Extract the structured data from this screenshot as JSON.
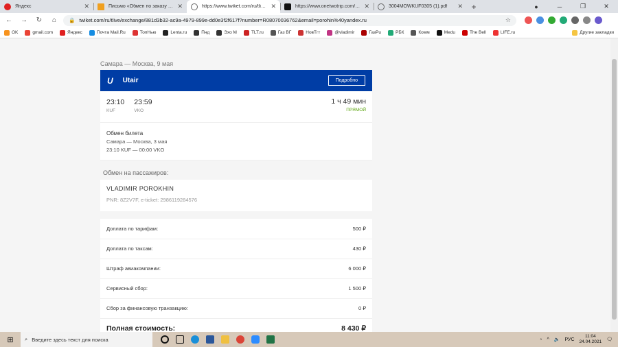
{
  "browser": {
    "tabs": [
      {
        "label": "Яндекс",
        "color": "#e02020",
        "active": false
      },
      {
        "label": "Письмо «Обмен по заказу R08",
        "color": "#f0a020",
        "active": false
      },
      {
        "label": "https://www.twiket.com/ru/tlive/",
        "color": "#666666",
        "active": true
      },
      {
        "label": "https://www.onetwotrip.com/ru/",
        "color": "#111111",
        "active": false
      },
      {
        "label": "3004MOWKUF0305 (1).pdf",
        "color": "#666666",
        "active": false
      }
    ],
    "url": "twiket.com/ru/tlive/exchange/881d3b32-ac9a-4979-899e-dd0e3f2f617f?number=R08070036762&email=porohin%40yandex.ru",
    "bookmarks": [
      {
        "label": "OK",
        "color": "#f7931e"
      },
      {
        "label": "gmail.com",
        "color": "#ea4335"
      },
      {
        "label": "Яндекс",
        "color": "#e02020"
      },
      {
        "label": "Почта Mail.Ru",
        "color": "#168de2"
      },
      {
        "label": "ТопНью",
        "color": "#d33"
      },
      {
        "label": "Lenta.ru",
        "color": "#222"
      },
      {
        "label": "Пнд",
        "color": "#333"
      },
      {
        "label": "Эхо М",
        "color": "#333"
      },
      {
        "label": "TLT.ru",
        "color": "#c22"
      },
      {
        "label": "Газ ВГ",
        "color": "#555"
      },
      {
        "label": "НовТгт",
        "color": "#c33"
      },
      {
        "label": "@vladimir",
        "color": "#c13584"
      },
      {
        "label": "ГазРu",
        "color": "#a00"
      },
      {
        "label": "РБК",
        "color": "#2a7"
      },
      {
        "label": "Комм",
        "color": "#555"
      },
      {
        "label": "Medu",
        "color": "#111"
      },
      {
        "label": "The Bell",
        "color": "#c00"
      },
      {
        "label": "LIFE.ru",
        "color": "#e33"
      }
    ],
    "other_bookmarks": "Другие закладки"
  },
  "trip": {
    "route_title": "Самара — Москва, 9 мая",
    "airline": "Utair",
    "details_button": "Подробно",
    "dep_time": "23:10",
    "dep_code": "KUF",
    "arr_time": "23:59",
    "arr_code": "VKO",
    "duration": "1 ч 49 мин",
    "flight_type": "прямой",
    "exchange_title": "Обмен билета",
    "exchange_route": "Самара — Москва, 3 мая",
    "exchange_times": "23:10 KUF — 00:00 VKO"
  },
  "passengers": {
    "title": "Обмен на пассажиров:",
    "name": "VLADIMIR POROKHIN",
    "pnr": "PNR: 8Z2V7F, e-ticket: 2986119284576"
  },
  "costs": {
    "rows": [
      {
        "label": "Доплата по тарифам:",
        "value": "500 ₽"
      },
      {
        "label": "Доплата по таксам:",
        "value": "430 ₽"
      },
      {
        "label": "Штраф авиакомпании:",
        "value": "6 000 ₽"
      },
      {
        "label": "Сервисный сбор:",
        "value": "1 500 ₽"
      },
      {
        "label": "Сбор за финансовую транзакцию:",
        "value": "0 ₽"
      }
    ],
    "total_label": "Полная стоимость:",
    "total_value": "8 430 ₽"
  },
  "taskbar": {
    "search_placeholder": "Введите здесь текст для поиска",
    "lang": "РУС",
    "time": "11:04",
    "date": "24.04.2021"
  }
}
